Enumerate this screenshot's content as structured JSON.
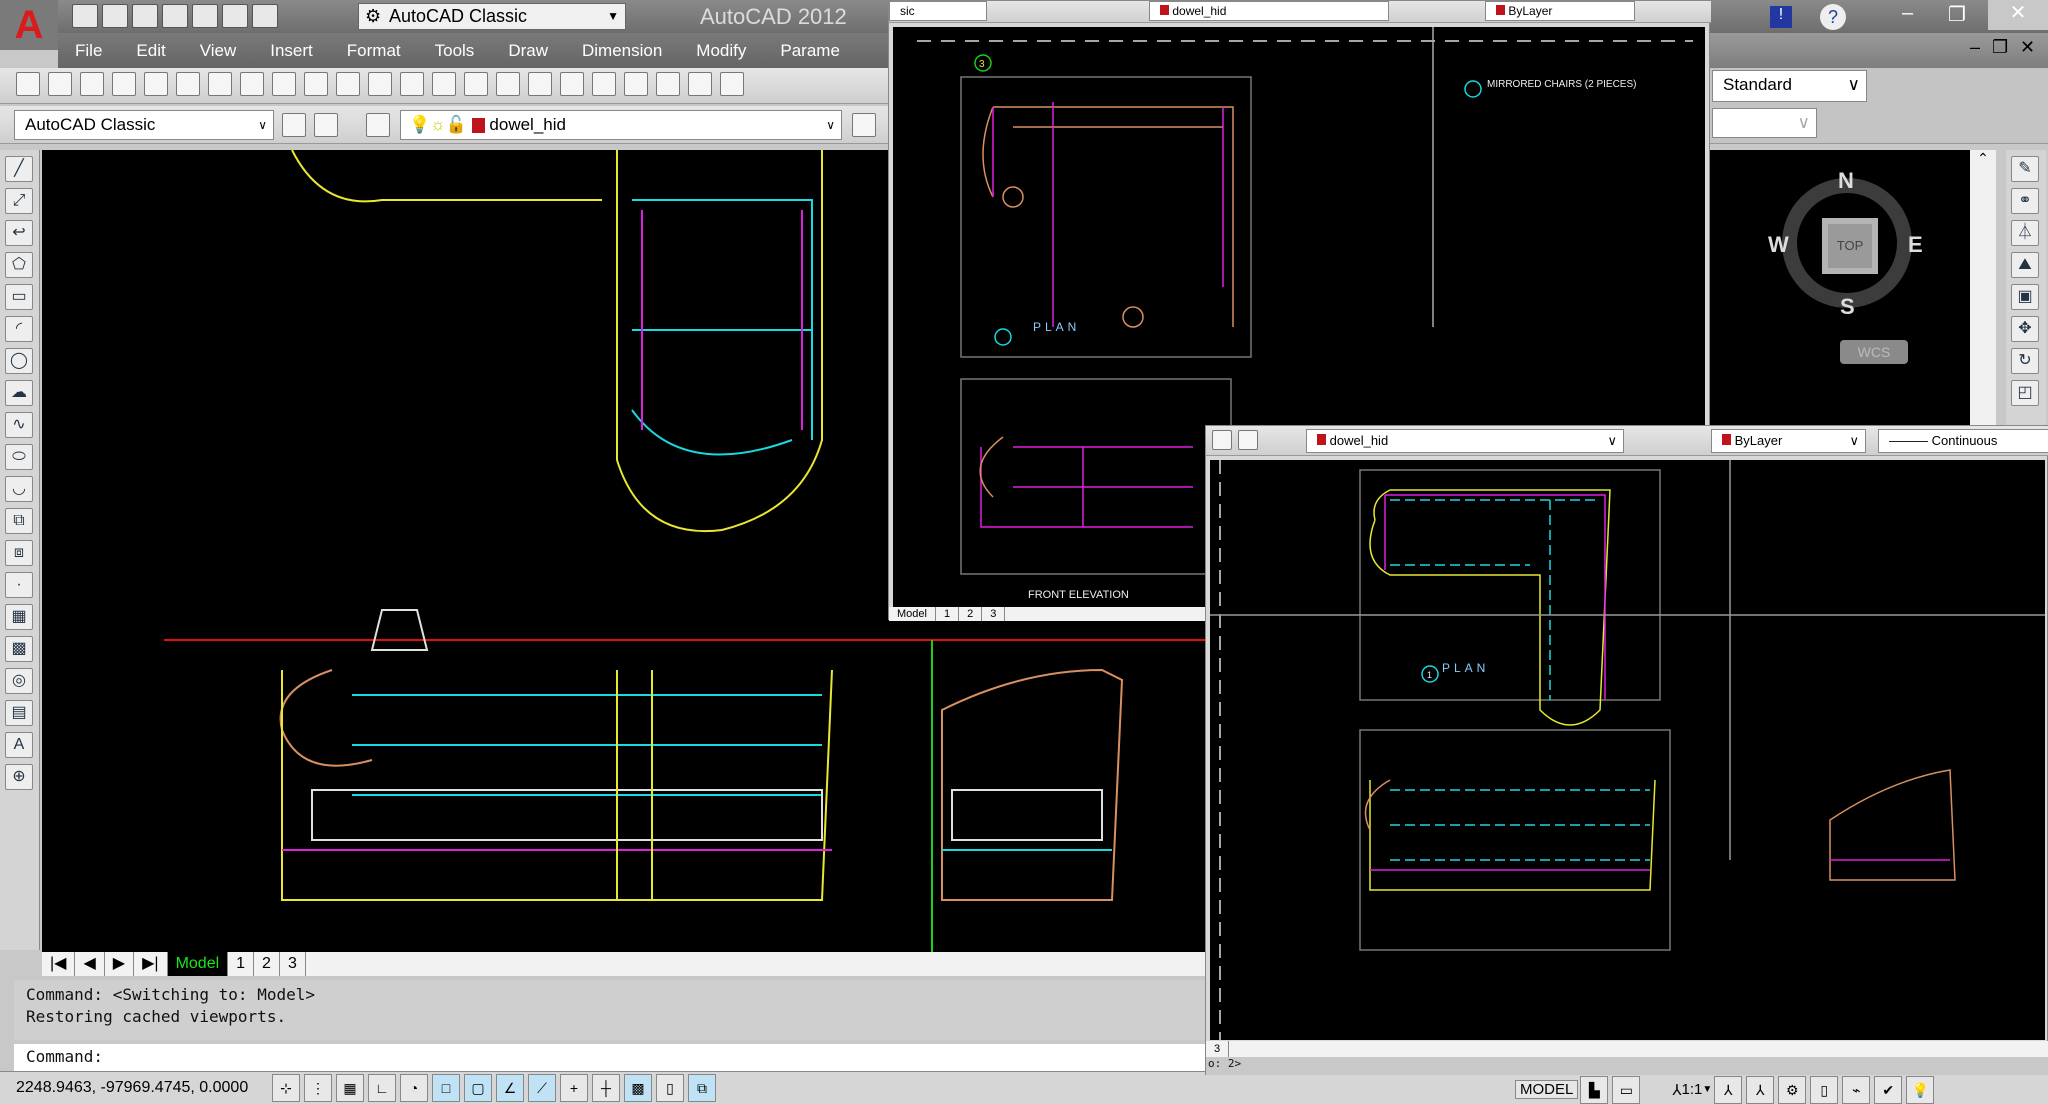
{
  "app": {
    "title": "AutoCAD 2012",
    "workspace": "AutoCAD Classic"
  },
  "menu": [
    "File",
    "Edit",
    "View",
    "Insert",
    "Format",
    "Tools",
    "Draw",
    "Dimension",
    "Modify",
    "Parame"
  ],
  "layers": {
    "workspace_drop": "AutoCAD Classic",
    "current_layer": "dowel_hid",
    "layer_color": "#c0141c",
    "text_style": "Standard",
    "color": "ByLayer",
    "linetype": "Continuous",
    "win2_workspace": "sic"
  },
  "layout_tabs": [
    "Model",
    "1",
    "2",
    "3"
  ],
  "command": {
    "history": [
      "Command:   <Switching to: Model>",
      "Restoring cached viewports."
    ],
    "prompt": "Command:",
    "win3_prompt": "o: 2>"
  },
  "status": {
    "coords": "2248.9463, -97969.4745, 0.0000",
    "model_label": "MODEL",
    "scale": "1:1"
  },
  "viewcube": {
    "n": "N",
    "s": "S",
    "e": "E",
    "w": "W",
    "face": "TOP",
    "ucs": "WCS"
  },
  "drawing_labels": {
    "plan": "PLAN",
    "front_elevation": "FRONT ELEVATION",
    "mirrored": "MIRRORED CHAIRS (2 PIECES)",
    "marker1": "1",
    "marker3": "3"
  },
  "colors": {
    "yellow": "#e8e830",
    "cyan": "#18d8e0",
    "magenta": "#e020e0",
    "white": "#e0e0e0",
    "orange": "#d89060",
    "red": "#e01010",
    "green": "#18d018",
    "blue": "#2040ff"
  }
}
